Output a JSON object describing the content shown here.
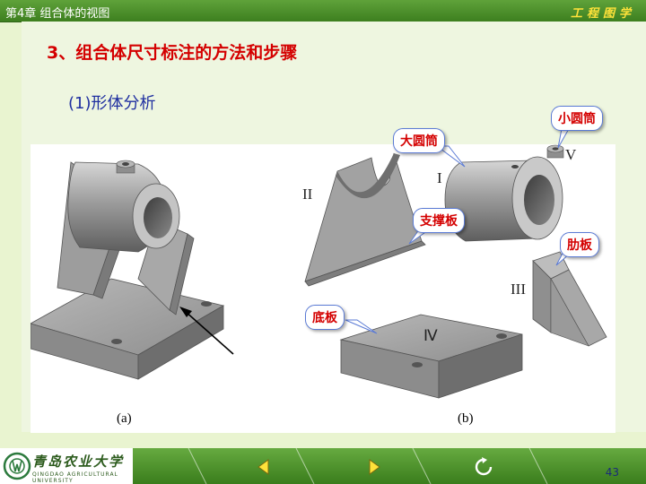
{
  "header": {
    "chapter": "第4章  组合体的视图",
    "brand": "工程图学"
  },
  "title": "3、组合体尺寸标注的方法和步骤",
  "subtitle": "(1)形体分析",
  "figure": {
    "caption_a": "(a)",
    "caption_b": "(b)",
    "roman": {
      "I": "I",
      "II": "II",
      "III": "III",
      "IV": "Ⅳ",
      "V": "V"
    }
  },
  "callouts": {
    "small_cylinder": "小圆筒",
    "large_cylinder": "大圆筒",
    "support_plate": "支撑板",
    "rib_plate": "肋板",
    "base_plate": "底板"
  },
  "footer": {
    "logo": "青岛农业大学",
    "logo_sub": "QINGDAO AGRICULTURAL UNIVERSITY",
    "page_number": "43",
    "icons": [
      "prev-arrow-icon",
      "next-arrow-icon",
      "return-icon"
    ]
  },
  "colors": {
    "title": "#d40000",
    "subtitle": "#1f2fa0",
    "bar_green": "#3d7f1f",
    "brand_yellow": "#ffe23a",
    "callout_border": "#5b7bd5"
  }
}
